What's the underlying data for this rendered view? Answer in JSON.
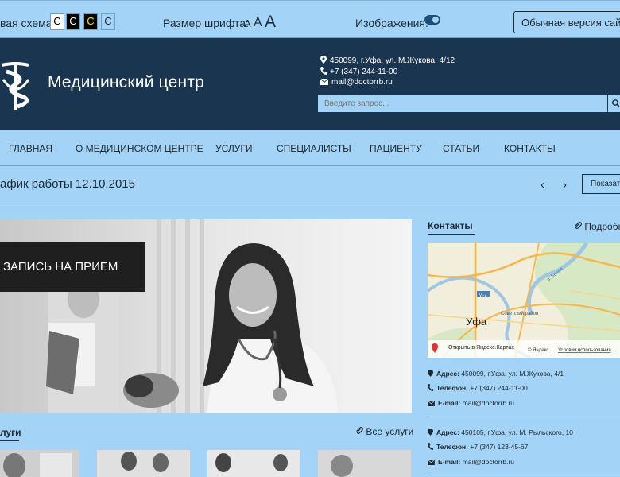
{
  "topbar": {
    "color_scheme_label": "вая схема:",
    "color_scheme_options": [
      "С",
      "С",
      "С",
      "С"
    ],
    "font_size_label": "Размер шрифта:",
    "font_size_options": [
      "А",
      "А",
      "А"
    ],
    "images_label": "Изображения:",
    "normal_version_label": "Обычная версия сайта"
  },
  "header": {
    "site_name": "Медицинский центр",
    "address": "450099, г.Уфа, ул. М.Жукова, 4/12",
    "phone": "+7 (347) 244-11-00",
    "email": "mail@doctorrb.ru",
    "search_placeholder": "Введите запрос..."
  },
  "nav": {
    "items": [
      "ГЛАВНАЯ",
      "О МЕДИЦИНСКОМ ЦЕНТРЕ",
      "УСЛУГИ",
      "СПЕЦИАЛИСТЫ",
      "ПАЦИЕНТУ",
      "СТАТЬИ",
      "КОНТАКТЫ"
    ]
  },
  "schedule": {
    "title": "афик работы 12.10.2015",
    "prev": "‹",
    "next": "›",
    "show_label": "Показать"
  },
  "hero": {
    "appointment_label": "ЗАПИСЬ НА ПРИЕМ"
  },
  "services": {
    "title": "луги",
    "all_link": "Все услуги"
  },
  "contacts": {
    "title": "Контакты",
    "more_link": "Подробнее",
    "map": {
      "city": "Уфа",
      "district": "Советский район",
      "road": "М-7",
      "river": "р. Белая",
      "open_link": "Открыть в Яндекс.Картах",
      "copyright": "© Яндекс",
      "terms": "Условия использования"
    },
    "blocks": [
      {
        "address_label": "Адрес:",
        "address": "450099, г.Уфа, ул. М.Жукова, 4/1",
        "phone_label": "Телефон:",
        "phone": "+7 (347) 244-11-00",
        "email_label": "E-mail:",
        "email": "mail@doctorrb.ru"
      },
      {
        "address_label": "Адрес:",
        "address": "450105, г.Уфа, ул. М. Рыльского, 10",
        "phone_label": "Телефон:",
        "phone": "+7 (347) 123-45-67",
        "email_label": "E-mail:",
        "email": "mail@doctorrb.ru"
      }
    ]
  },
  "colors": {
    "background": "#a3d4f7",
    "header": "#1a3550",
    "text": "#1e2a33"
  }
}
